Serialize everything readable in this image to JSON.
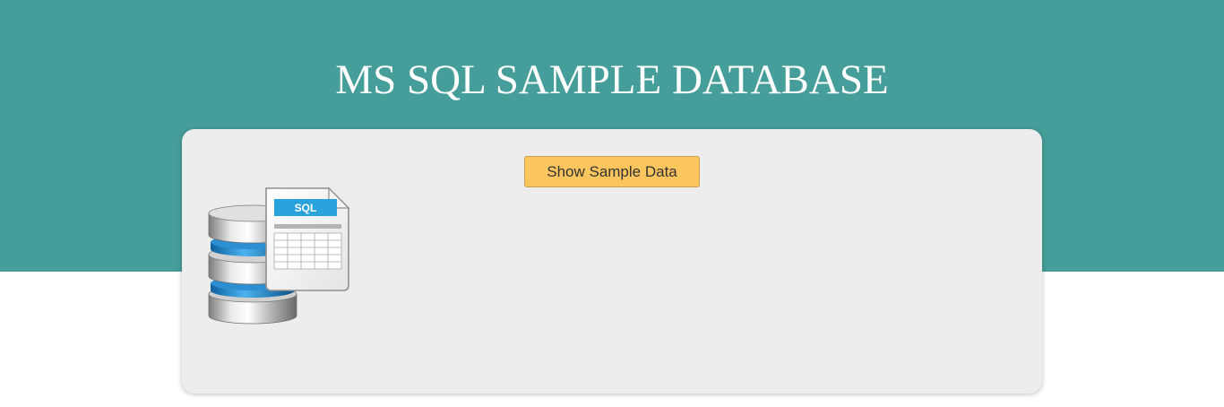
{
  "header": {
    "title": "MS SQL SAMPLE DATABASE"
  },
  "main": {
    "show_button_label": "Show Sample Data",
    "illustration": {
      "icon": "sql-database-icon",
      "badge_text": "SQL"
    }
  },
  "colors": {
    "banner": "#469e9a",
    "card": "#ededed",
    "button": "#fdc55e",
    "badge": "#2aa3dd"
  }
}
